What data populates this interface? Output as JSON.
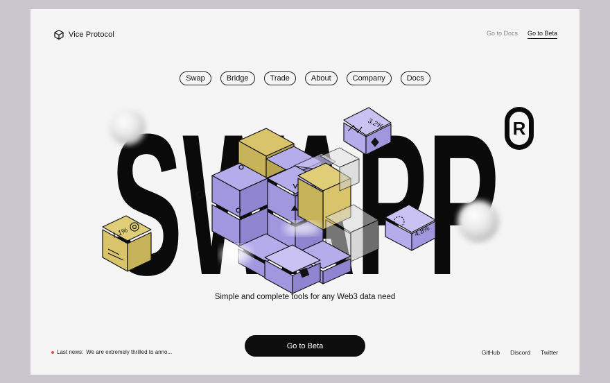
{
  "brand": {
    "name": "Vice Protocol",
    "logo_icon": "cube-logo-icon"
  },
  "top_links": [
    {
      "label": "Go to Docs",
      "active": false
    },
    {
      "label": "Go to Beta",
      "active": true
    }
  ],
  "nav": [
    "Swap",
    "Bridge",
    "Trade",
    "About",
    "Company",
    "Docs"
  ],
  "hero": {
    "title": "SWAPP",
    "registered_mark": "R",
    "cube_labels": {
      "left": "1.1%",
      "top_right": "3.2%",
      "right": "4.8%"
    }
  },
  "tagline": "Simple and complete tools for any Web3 data need",
  "cta_label": "Go to Beta",
  "news": {
    "prefix": "Last news:",
    "text": "We are extremely thrilled to anno..."
  },
  "socials": [
    "GitHub",
    "Discord",
    "Twitter"
  ],
  "colors": {
    "accent_purple": "#a89fe0",
    "accent_gold": "#d9c46c",
    "ink": "#0d0d0d",
    "background": "#f5f5f5",
    "news_dot": "#e84a4a"
  }
}
